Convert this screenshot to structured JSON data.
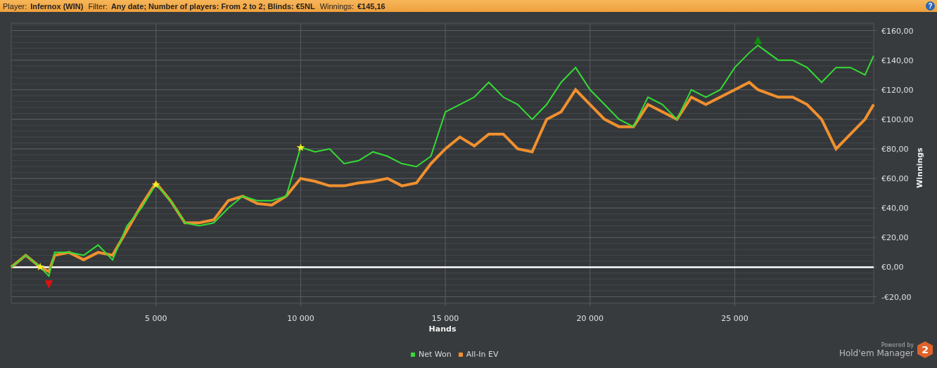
{
  "header": {
    "fields": [
      {
        "label": "Player:",
        "value": "Infernox (WIN)"
      },
      {
        "label": "Filter:",
        "value": "Any date; Number of players: From 2 to 2; Blinds: €5NL"
      },
      {
        "label": "Winnings:",
        "value": "€145,16"
      }
    ],
    "help_label": "?"
  },
  "chart": {
    "chart_data": {
      "type": "line",
      "xlabel": "Hands",
      "ylabel": "Winnings",
      "x": [
        0,
        500,
        1000,
        1300,
        1500,
        2000,
        2500,
        3000,
        3500,
        4000,
        4500,
        5000,
        5500,
        6000,
        6500,
        7000,
        7500,
        8000,
        8500,
        9000,
        9500,
        10000,
        10500,
        11000,
        11500,
        12000,
        12500,
        13000,
        13500,
        14000,
        14500,
        15000,
        15500,
        16000,
        16500,
        17000,
        17500,
        18000,
        18500,
        19000,
        19500,
        20000,
        20500,
        21000,
        21500,
        22000,
        22500,
        23000,
        23500,
        24000,
        24500,
        25000,
        25500,
        25800,
        26500,
        27000,
        27500,
        28000,
        28500,
        29000,
        29500,
        29800
      ],
      "series": [
        {
          "name": "Net Won",
          "color": "#33dd33",
          "values": [
            0,
            8,
            0,
            -6,
            10,
            10,
            8,
            15,
            5,
            28,
            40,
            56,
            45,
            30,
            28,
            30,
            40,
            48,
            45,
            45,
            48,
            81,
            78,
            80,
            70,
            72,
            78,
            75,
            70,
            68,
            75,
            105,
            110,
            115,
            125,
            115,
            110,
            100,
            110,
            125,
            135,
            120,
            110,
            100,
            95,
            115,
            110,
            100,
            120,
            115,
            120,
            135,
            145,
            150,
            140,
            140,
            135,
            125,
            135,
            135,
            130,
            143
          ]
        },
        {
          "name": "All-In EV",
          "color": "#f0902e",
          "values": [
            0,
            8,
            0,
            -3,
            8,
            10,
            5,
            10,
            8,
            25,
            42,
            57,
            45,
            30,
            30,
            32,
            45,
            48,
            43,
            42,
            48,
            60,
            58,
            55,
            55,
            57,
            58,
            60,
            55,
            57,
            70,
            80,
            88,
            82,
            90,
            90,
            80,
            78,
            100,
            105,
            120,
            110,
            100,
            95,
            95,
            110,
            105,
            100,
            115,
            110,
            115,
            120,
            125,
            120,
            115,
            115,
            110,
            100,
            80,
            90,
            100,
            110
          ]
        }
      ],
      "xlim": [
        0,
        29800
      ],
      "ylim": [
        -24.5,
        165
      ],
      "xticks": [
        {
          "value": 5000,
          "label": "5 000"
        },
        {
          "value": 10000,
          "label": "10 000"
        },
        {
          "value": 15000,
          "label": "15 000"
        },
        {
          "value": 20000,
          "label": "20 000"
        },
        {
          "value": 25000,
          "label": "25 000"
        }
      ],
      "yticks": [
        {
          "value": 160,
          "label": "€160,00"
        },
        {
          "value": 140,
          "label": "€140,00"
        },
        {
          "value": 120,
          "label": "€120,00"
        },
        {
          "value": 100,
          "label": "€100,00"
        },
        {
          "value": 80,
          "label": "€80,00"
        },
        {
          "value": 60,
          "label": "€60,00"
        },
        {
          "value": 40,
          "label": "€40,00"
        },
        {
          "value": 20,
          "label": "€20,00"
        },
        {
          "value": 0,
          "label": "€0,00"
        },
        {
          "value": -20,
          "label": "-€20,00"
        }
      ],
      "annotations": [
        {
          "text": "★",
          "x": 1000,
          "y": 0
        },
        {
          "text": "★",
          "x": 5000,
          "y": 56
        },
        {
          "text": "★",
          "x": 10000,
          "y": 81
        },
        {
          "text": "▼",
          "x": 1300,
          "y": -6
        },
        {
          "text": "▲",
          "x": 25800,
          "y": 150
        }
      ],
      "grid": true
    },
    "markers": [
      {
        "kind": "star",
        "color": "#f4f02a"
      },
      {
        "kind": "star",
        "color": "#f4f02a"
      },
      {
        "kind": "star",
        "color": "#f4f02a"
      },
      {
        "kind": "low",
        "color": "#e01010"
      },
      {
        "kind": "high",
        "color": "#108a10"
      }
    ]
  },
  "branding": {
    "powered_by": "Powered by",
    "product": "Hold'em Manager",
    "logo_text": "2"
  }
}
